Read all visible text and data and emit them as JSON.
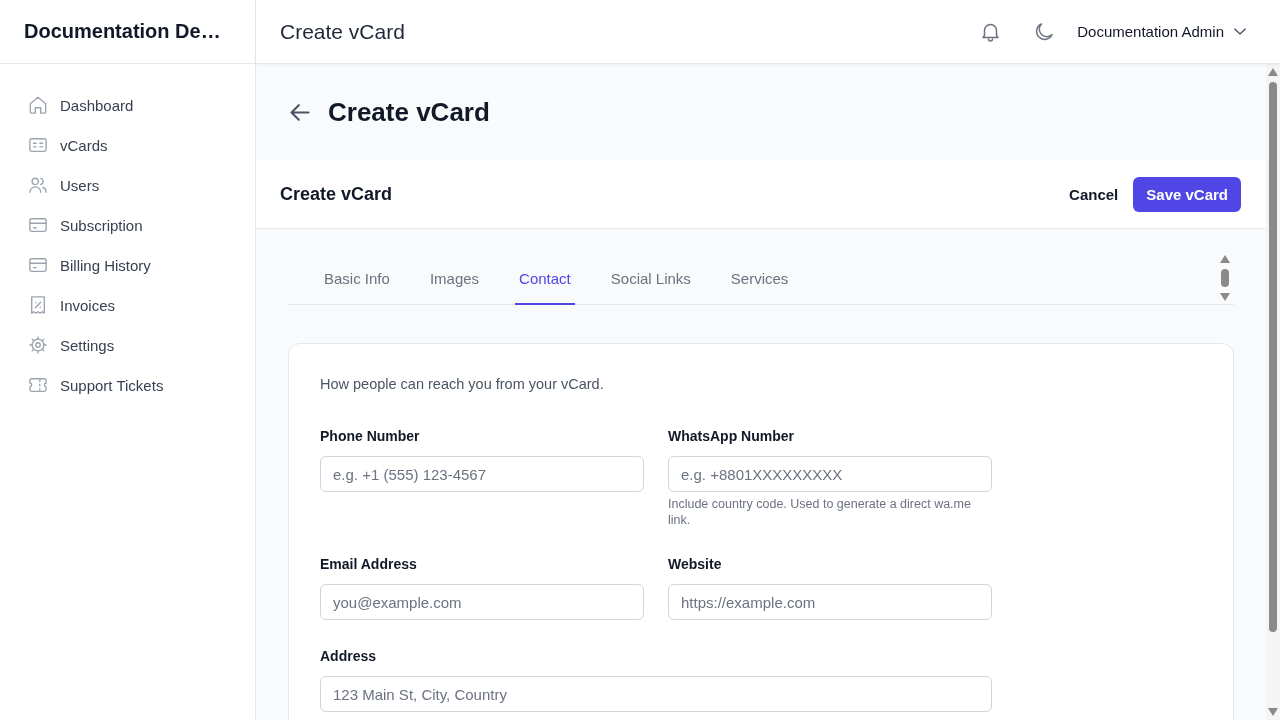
{
  "sidebar": {
    "brand": "Documentation De…",
    "items": [
      {
        "label": "Dashboard",
        "selected": false
      },
      {
        "label": "vCards",
        "selected": false
      },
      {
        "label": "Users",
        "selected": false
      },
      {
        "label": "Subscription",
        "selected": false
      },
      {
        "label": "Billing History",
        "selected": false
      },
      {
        "label": "Invoices",
        "selected": false
      },
      {
        "label": "Settings",
        "selected": false
      },
      {
        "label": "Support Tickets",
        "selected": false
      }
    ]
  },
  "topbar": {
    "title": "Create vCard",
    "user": "Documentation Admin"
  },
  "page_header": {
    "title": "Create vCard"
  },
  "form_header": {
    "title": "Create vCard",
    "buttons": [
      {
        "label": "Cancel",
        "kind": "text"
      },
      {
        "label": "Save vCard",
        "kind": "primary"
      }
    ]
  },
  "tabs": [
    {
      "label": "Basic Info",
      "selected": false
    },
    {
      "label": "Images",
      "selected": false
    },
    {
      "label": "Contact",
      "selected": true
    },
    {
      "label": "Social Links",
      "selected": false
    },
    {
      "label": "Services",
      "selected": false
    }
  ],
  "contact_card": {
    "description": "How people can reach you from your vCard.",
    "fields": [
      {
        "kind": "half",
        "label": "Phone Number",
        "placeholder": "e.g. +1 (555) 123-4567"
      },
      {
        "kind": "half",
        "label": "WhatsApp Number",
        "placeholder": "e.g. +8801XXXXXXXXX",
        "help": "Include country code. Used to generate a direct wa.me link."
      },
      {
        "kind": "half",
        "label": "Email Address",
        "placeholder": "you@example.com"
      },
      {
        "kind": "half",
        "label": "Website",
        "placeholder": "https://example.com"
      },
      {
        "kind": "full",
        "label": "Address",
        "placeholder": "123 Main St, City, Country"
      }
    ]
  }
}
